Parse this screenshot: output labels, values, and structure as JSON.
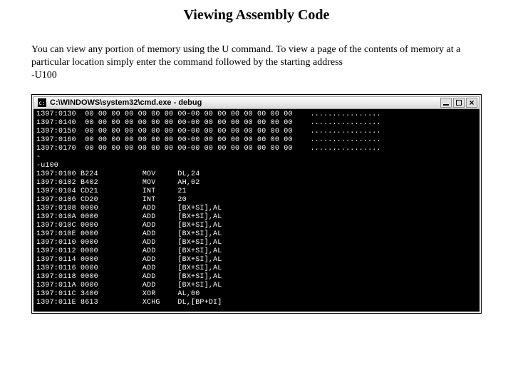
{
  "heading": "Viewing Assembly Code",
  "paragraph": "You can view any portion of memory using the U command.  To view a page of the contents of memory at a particular location simply enter the command followed by the starting address",
  "example_cmd": "-U100",
  "console": {
    "title": "C:\\WINDOWS\\system32\\cmd.exe - debug",
    "dump_rows": [
      {
        "addr": "1397:0130",
        "hex": "00 00 00 00 00 00 00 00-00 00 00 00 00 00 00 00",
        "ascii": "................"
      },
      {
        "addr": "1397:0140",
        "hex": "00 00 00 00 00 00 00 00-00 00 00 00 00 00 00 00",
        "ascii": "................"
      },
      {
        "addr": "1397:0150",
        "hex": "00 00 00 00 00 00 00 00-00 00 00 00 00 00 00 00",
        "ascii": "................"
      },
      {
        "addr": "1397:0160",
        "hex": "00 00 00 00 00 00 00 00-00 00 00 00 00 00 00 00",
        "ascii": "................"
      },
      {
        "addr": "1397:0170",
        "hex": "00 00 00 00 00 00 00 00-00 00 00 00 00 00 00 00",
        "ascii": "................"
      }
    ],
    "prompt1": "-",
    "command": "-u100",
    "disasm_rows": [
      {
        "addr": "1397:0100",
        "bytes": "B224",
        "mnem": "MOV",
        "ops": "DL,24"
      },
      {
        "addr": "1397:0102",
        "bytes": "B402",
        "mnem": "MOV",
        "ops": "AH,02"
      },
      {
        "addr": "1397:0104",
        "bytes": "CD21",
        "mnem": "INT",
        "ops": "21"
      },
      {
        "addr": "1397:0106",
        "bytes": "CD20",
        "mnem": "INT",
        "ops": "20"
      },
      {
        "addr": "1397:0108",
        "bytes": "0000",
        "mnem": "ADD",
        "ops": "[BX+SI],AL"
      },
      {
        "addr": "1397:010A",
        "bytes": "0000",
        "mnem": "ADD",
        "ops": "[BX+SI],AL"
      },
      {
        "addr": "1397:010C",
        "bytes": "0000",
        "mnem": "ADD",
        "ops": "[BX+SI],AL"
      },
      {
        "addr": "1397:010E",
        "bytes": "0000",
        "mnem": "ADD",
        "ops": "[BX+SI],AL"
      },
      {
        "addr": "1397:0110",
        "bytes": "0000",
        "mnem": "ADD",
        "ops": "[BX+SI],AL"
      },
      {
        "addr": "1397:0112",
        "bytes": "0000",
        "mnem": "ADD",
        "ops": "[BX+SI],AL"
      },
      {
        "addr": "1397:0114",
        "bytes": "0000",
        "mnem": "ADD",
        "ops": "[BX+SI],AL"
      },
      {
        "addr": "1397:0116",
        "bytes": "0000",
        "mnem": "ADD",
        "ops": "[BX+SI],AL"
      },
      {
        "addr": "1397:0118",
        "bytes": "0000",
        "mnem": "ADD",
        "ops": "[BX+SI],AL"
      },
      {
        "addr": "1397:011A",
        "bytes": "0000",
        "mnem": "ADD",
        "ops": "[BX+SI],AL"
      },
      {
        "addr": "1397:011C",
        "bytes": "3400",
        "mnem": "XOR",
        "ops": "AL,00"
      },
      {
        "addr": "1397:011E",
        "bytes": "8613",
        "mnem": "XCHG",
        "ops": "DL,[BP+DI]"
      }
    ]
  }
}
